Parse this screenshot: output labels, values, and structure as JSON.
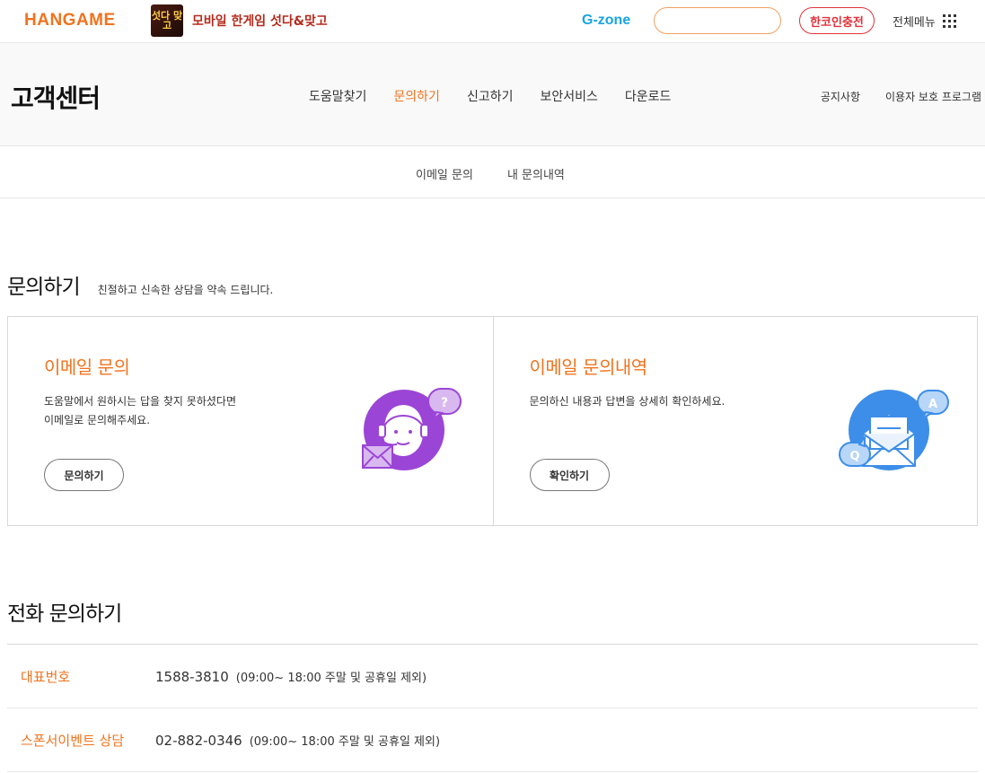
{
  "topbar": {
    "logo": "HANGAME",
    "promo_thumb": "섯다 맞고",
    "promo_text": "모바일 한게임 섯다&맞고",
    "gzone": "G-zone",
    "search_placeholder": "",
    "charge_label": "한코인충전",
    "allmenu_label": "전체메뉴"
  },
  "header": {
    "title": "고객센터",
    "nav": [
      "도움말찾기",
      "문의하기",
      "신고하기",
      "보안서비스",
      "다운로드"
    ],
    "nav_active_index": 1,
    "util": [
      "공지사항",
      "이용자 보호 프로그램"
    ]
  },
  "subnav": [
    "이메일 문의",
    "내 문의내역"
  ],
  "section": {
    "title": "문의하기",
    "subtitle": "친절하고 신속한 상담을 약속 드립니다."
  },
  "cards": [
    {
      "title": "이메일 문의",
      "desc_line1": "도움말에서 원하시는 답을 찾지 못하셨다면",
      "desc_line2": "이메일로 문의해주세요.",
      "button": "문의하기"
    },
    {
      "title": "이메일 문의내역",
      "desc_line1": "문의하신 내용과 답변을 상세히 확인하세요.",
      "desc_line2": "",
      "button": "확인하기"
    }
  ],
  "phone": {
    "title": "전화 문의하기",
    "rows": [
      {
        "label": "대표번호",
        "number": "1588-3810",
        "hours": "(09:00~ 18:00 주말 및 공휴일 제외)"
      },
      {
        "label": "스폰서이벤트 상담",
        "number": "02-882-0346",
        "hours": "(09:00~ 18:00 주말 및 공휴일 제외)"
      }
    ]
  },
  "colors": {
    "accent": "#f0731e",
    "charge_red": "#e0323a",
    "gzone_blue": "#18a5e0",
    "icon_purple": "#9b45d6",
    "icon_blue": "#3d8ee8"
  },
  "icons": {
    "card1": "support-agent-icon",
    "card2": "mail-qa-icon"
  }
}
